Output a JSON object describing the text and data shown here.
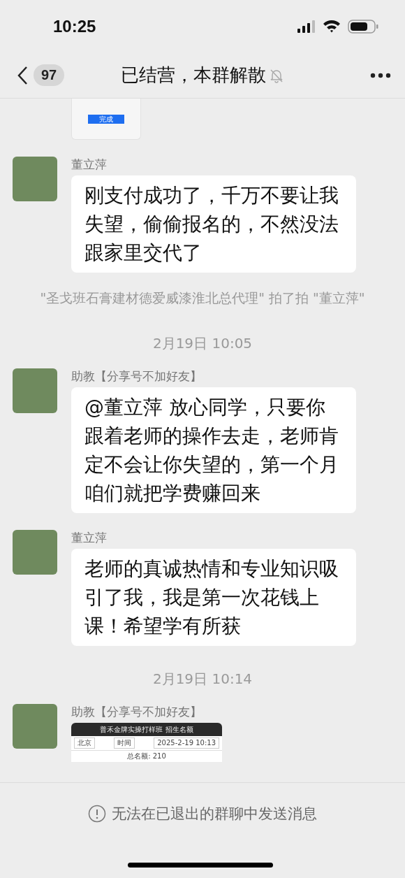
{
  "status_bar": {
    "time": "10:25"
  },
  "nav": {
    "back_count": "97",
    "title": "已结营，本群解散",
    "muted": true
  },
  "messages": [
    {
      "kind": "image",
      "image": {
        "kind": "button",
        "label": "完成"
      }
    },
    {
      "kind": "text",
      "sender": "董立萍",
      "text": "刚支付成功了，千万不要让我失望，偷偷报名的，不然没法跟家里交代了"
    },
    {
      "kind": "system",
      "text": "\"圣戈班石膏建材德爱威漆淮北总代理\" 拍了拍 \"董立萍\""
    },
    {
      "kind": "time",
      "text": "2月19日 10:05"
    },
    {
      "kind": "text",
      "sender": "助教【分享号不加好友】",
      "text": "@董立萍 放心同学，只要你跟着老师的操作去走，老师肯定不会让你失望的，第一个月咱们就把学费赚回来"
    },
    {
      "kind": "text",
      "sender": "董立萍",
      "text": "老师的真诚热情和专业知识吸引了我，我是第一次花钱上课！希望学有所获"
    },
    {
      "kind": "time",
      "text": "2月19日 10:14"
    },
    {
      "kind": "image",
      "sender": "助教【分享号不加好友】",
      "image": {
        "kind": "table",
        "title": "普禾金牌实操打样班 招生名额",
        "cells": [
          "北京",
          "时间",
          "2025-2-19 10:13"
        ],
        "total": "总名额: 210"
      }
    }
  ],
  "footer": {
    "notice": "无法在已退出的群聊中发送消息"
  }
}
